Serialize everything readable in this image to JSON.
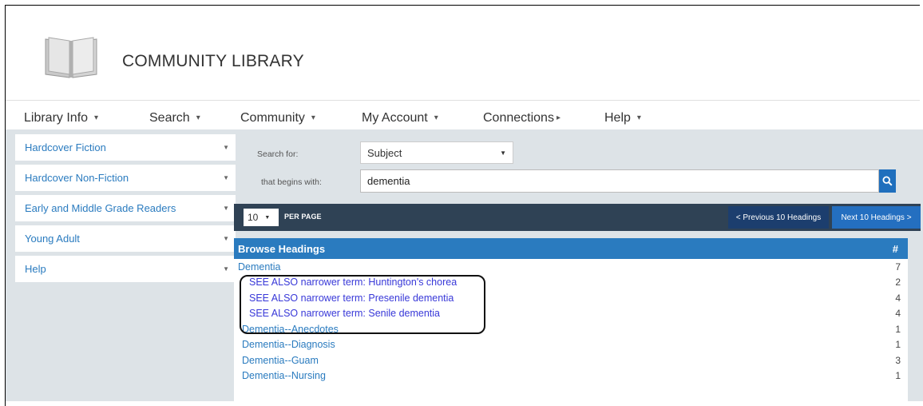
{
  "app": {
    "title": "COMMUNITY LIBRARY"
  },
  "nav": {
    "items": [
      {
        "label": "Library Info",
        "caret": "▾"
      },
      {
        "label": "Search",
        "caret": "▾"
      },
      {
        "label": "Community",
        "caret": "▾"
      },
      {
        "label": "My Account",
        "caret": "▾"
      },
      {
        "label": "Connections",
        "caret": "▸"
      },
      {
        "label": "Help",
        "caret": "▾"
      }
    ]
  },
  "sidebar": {
    "items": [
      {
        "label": "Hardcover Fiction"
      },
      {
        "label": "Hardcover Non-Fiction"
      },
      {
        "label": "Early and Middle Grade Readers"
      },
      {
        "label": "Young Adult"
      },
      {
        "label": "Help"
      }
    ]
  },
  "search": {
    "search_for_label": "Search for:",
    "search_for_value": "Subject",
    "begins_with_label": "that begins with:",
    "query": "dementia"
  },
  "toolbar": {
    "per_page_value": "10",
    "per_page_label": "PER PAGE",
    "prev_label": "< Previous 10 Headings",
    "next_label": "Next 10 Headings >"
  },
  "results": {
    "header_label": "Browse Headings",
    "count_header": "#",
    "rows": [
      {
        "heading": "Dementia",
        "count": "7"
      },
      {
        "heading": "SEE ALSO narrower term: Huntington's chorea",
        "count": "2"
      },
      {
        "heading": "SEE ALSO narrower term: Presenile dementia",
        "count": "4"
      },
      {
        "heading": "SEE ALSO narrower term: Senile dementia",
        "count": "4"
      },
      {
        "heading": "Dementia--Anecdotes",
        "count": "1"
      },
      {
        "heading": "Dementia--Diagnosis",
        "count": "1"
      },
      {
        "heading": "Dementia--Guam",
        "count": "3"
      },
      {
        "heading": "Dementia--Nursing",
        "count": "1"
      }
    ]
  },
  "colors": {
    "link": "#2a7bbf",
    "see_also_link": "#3838d8",
    "toolbar_bg": "#2f4255",
    "header_bg": "#2a7bbf",
    "content_bg": "#dde3e7"
  },
  "icons": {
    "logo": "open-book-icon",
    "search": "search-icon"
  }
}
